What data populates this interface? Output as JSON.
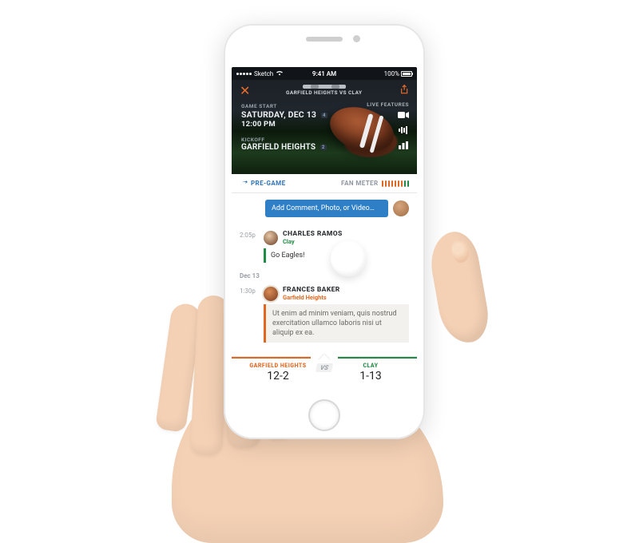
{
  "statusbar": {
    "carrier": "Sketch",
    "time": "9:41 AM",
    "battery": "100%"
  },
  "header": {
    "matchup": "GARFIELD HEIGHTS VS CLAY",
    "game_start_label": "GAME START",
    "game_start_day": "SATURDAY, DEC 13",
    "game_start_time": "12:00 PM",
    "game_start_badge": "4",
    "kickoff_label": "KICKOFF",
    "kickoff_team": "GARFIELD HEIGHTS",
    "kickoff_badge": "2",
    "live_features_label": "LIVE FEATURES"
  },
  "subbar": {
    "pregame": "PRE-GAME",
    "fanmeter_label": "FAN METER"
  },
  "fanmeter_colors": [
    "#e0671f",
    "#e0671f",
    "#e0671f",
    "#e0671f",
    "#e0671f",
    "#e0671f",
    "#e0671f",
    "#1f8b46",
    "#1f8b46"
  ],
  "comment": {
    "placeholder": "Add Comment, Photo, or Video…"
  },
  "feed": [
    {
      "time": "2:05p",
      "user": "CHARLES RAMOS",
      "team": "Clay",
      "team_style": "green",
      "avatar": "cr",
      "message": "Go Eagles!",
      "msg_style": ""
    },
    {
      "date": "Dec 13",
      "time": "1:30p",
      "user": "FRANCES BAKER",
      "team": "Garfield Heights",
      "team_style": "orange",
      "avatar": "fb",
      "message": "Ut enim ad minim veniam, quis nostrud exercitation ullamco laboris nisi ut aliquip ex ea.",
      "msg_style": "long"
    }
  ],
  "scorebar": {
    "left_team": "GARFIELD HEIGHTS",
    "left_record": "12-2",
    "vs": "VS",
    "right_team": "CLAY",
    "right_record": "1-13"
  }
}
